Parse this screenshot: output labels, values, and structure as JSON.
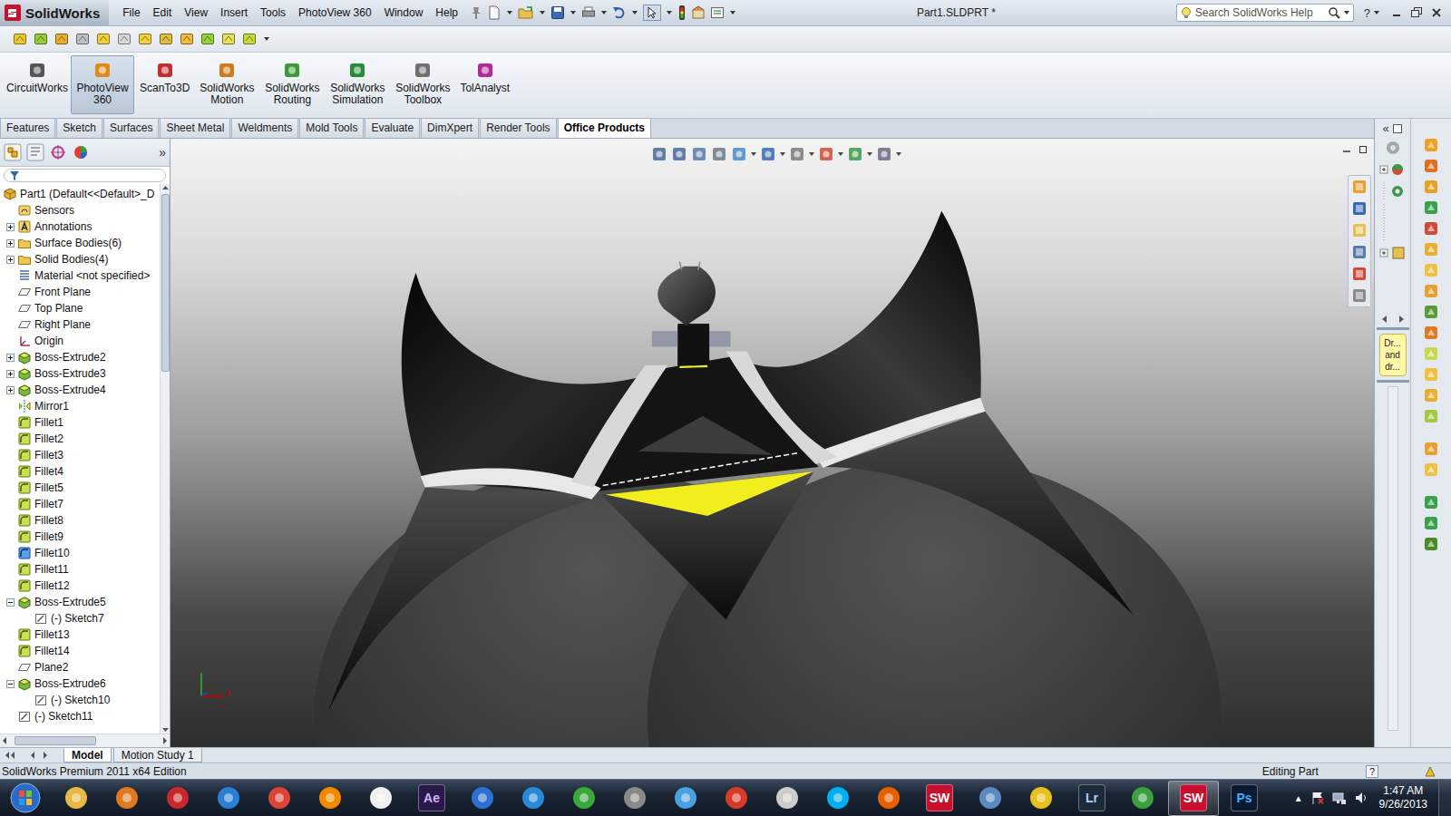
{
  "window": {
    "app": "SolidWorks",
    "title": "Part1.SLDPRT *"
  },
  "menu": [
    "File",
    "Edit",
    "View",
    "Insert",
    "Tools",
    "PhotoView 360",
    "Window",
    "Help"
  ],
  "search": {
    "placeholder": "Search SolidWorks Help"
  },
  "help": "?",
  "command_manager": [
    {
      "label": "CircuitWorks",
      "selected": false,
      "color": "#555555"
    },
    {
      "label": "PhotoView 360",
      "selected": true,
      "color": "#e08a1e"
    },
    {
      "label": "ScanTo3D",
      "selected": false,
      "color": "#c03030"
    },
    {
      "label": "SolidWorks Motion",
      "selected": false,
      "color": "#d07a20"
    },
    {
      "label": "SolidWorks Routing",
      "selected": false,
      "color": "#3a9a3a"
    },
    {
      "label": "SolidWorks Simulation",
      "selected": false,
      "color": "#2a8a3a"
    },
    {
      "label": "SolidWorks Toolbox",
      "selected": false,
      "color": "#707070"
    },
    {
      "label": "TolAnalyst",
      "selected": false,
      "color": "#b02a9a"
    }
  ],
  "tabs": [
    {
      "label": "Features",
      "selected": false
    },
    {
      "label": "Sketch",
      "selected": false
    },
    {
      "label": "Surfaces",
      "selected": false
    },
    {
      "label": "Sheet Metal",
      "selected": false
    },
    {
      "label": "Weldments",
      "selected": false
    },
    {
      "label": "Mold Tools",
      "selected": false
    },
    {
      "label": "Evaluate",
      "selected": false
    },
    {
      "label": "DimXpert",
      "selected": false
    },
    {
      "label": "Render Tools",
      "selected": false
    },
    {
      "label": "Office Products",
      "selected": true
    }
  ],
  "feature_tree": {
    "more": "»",
    "items": [
      {
        "label": "Part1  (Default<<Default>_D",
        "kind": "part",
        "depth": 0,
        "expandable": false,
        "expanded": false
      },
      {
        "label": "Sensors",
        "kind": "sensor",
        "depth": 1,
        "expandable": false,
        "expanded": false
      },
      {
        "label": "Annotations",
        "kind": "annotation",
        "depth": 1,
        "expandable": true,
        "expanded": false
      },
      {
        "label": "Surface Bodies(6)",
        "kind": "folder",
        "depth": 1,
        "expandable": true,
        "expanded": false
      },
      {
        "label": "Solid Bodies(4)",
        "kind": "folder",
        "depth": 1,
        "expandable": true,
        "expanded": false
      },
      {
        "label": "Material <not specified>",
        "kind": "material",
        "depth": 1,
        "expandable": false,
        "expanded": false
      },
      {
        "label": "Front Plane",
        "kind": "plane",
        "depth": 1,
        "expandable": false,
        "expanded": false
      },
      {
        "label": "Top Plane",
        "kind": "plane",
        "depth": 1,
        "expandable": false,
        "expanded": false
      },
      {
        "label": "Right Plane",
        "kind": "plane",
        "depth": 1,
        "expandable": false,
        "expanded": false
      },
      {
        "label": "Origin",
        "kind": "origin",
        "depth": 1,
        "expandable": false,
        "expanded": false
      },
      {
        "label": "Boss-Extrude2",
        "kind": "extrude",
        "depth": 1,
        "expandable": true,
        "expanded": false
      },
      {
        "label": "Boss-Extrude3",
        "kind": "extrude",
        "depth": 1,
        "expandable": true,
        "expanded": false
      },
      {
        "label": "Boss-Extrude4",
        "kind": "extrude",
        "depth": 1,
        "expandable": true,
        "expanded": false
      },
      {
        "label": "Mirror1",
        "kind": "mirror",
        "depth": 1,
        "expandable": false,
        "expanded": false
      },
      {
        "label": "Fillet1",
        "kind": "fillet",
        "depth": 1,
        "expandable": false,
        "expanded": false
      },
      {
        "label": "Fillet2",
        "kind": "fillet",
        "depth": 1,
        "expandable": false,
        "expanded": false
      },
      {
        "label": "Fillet3",
        "kind": "fillet",
        "depth": 1,
        "expandable": false,
        "expanded": false
      },
      {
        "label": "Fillet4",
        "kind": "fillet",
        "depth": 1,
        "expandable": false,
        "expanded": false
      },
      {
        "label": "Fillet5",
        "kind": "fillet",
        "depth": 1,
        "expandable": false,
        "expanded": false
      },
      {
        "label": "Fillet7",
        "kind": "fillet",
        "depth": 1,
        "expandable": false,
        "expanded": false
      },
      {
        "label": "Fillet8",
        "kind": "fillet",
        "depth": 1,
        "expandable": false,
        "expanded": false
      },
      {
        "label": "Fillet9",
        "kind": "fillet",
        "depth": 1,
        "expandable": false,
        "expanded": false
      },
      {
        "label": "Fillet10",
        "kind": "variable-fillet",
        "depth": 1,
        "expandable": false,
        "expanded": false
      },
      {
        "label": "Fillet11",
        "kind": "fillet",
        "depth": 1,
        "expandable": false,
        "expanded": false
      },
      {
        "label": "Fillet12",
        "kind": "fillet",
        "depth": 1,
        "expandable": false,
        "expanded": false
      },
      {
        "label": "Boss-Extrude5",
        "kind": "extrude",
        "depth": 1,
        "expandable": true,
        "expanded": true
      },
      {
        "label": "(-) Sketch7",
        "kind": "sketch",
        "depth": 2,
        "expandable": false,
        "expanded": false
      },
      {
        "label": "Fillet13",
        "kind": "fillet",
        "depth": 1,
        "expandable": false,
        "expanded": false
      },
      {
        "label": "Fillet14",
        "kind": "fillet",
        "depth": 1,
        "expandable": false,
        "expanded": false
      },
      {
        "label": "Plane2",
        "kind": "plane",
        "depth": 1,
        "expandable": false,
        "expanded": false
      },
      {
        "label": "Boss-Extrude6",
        "kind": "extrude",
        "depth": 1,
        "expandable": true,
        "expanded": true
      },
      {
        "label": "(-) Sketch10",
        "kind": "sketch",
        "depth": 2,
        "expandable": false,
        "expanded": false
      },
      {
        "label": "(-) Sketch11",
        "kind": "sketch",
        "depth": 1,
        "expandable": false,
        "expanded": false
      }
    ]
  },
  "viewport": {
    "triad_x": "x"
  },
  "task_pane": {
    "collapse": "«",
    "note": [
      "Dr...",
      "and",
      "dr..."
    ]
  },
  "model_tabs": [
    {
      "label": "Model",
      "selected": true
    },
    {
      "label": "Motion Study 1",
      "selected": false
    }
  ],
  "status_bar": {
    "edition": "SolidWorks Premium 2011 x64 Edition",
    "mode": "Editing Part",
    "help": "?"
  },
  "taskbar": {
    "apps": [
      {
        "color": "#e8b84a",
        "selected": false
      },
      {
        "color": "#e07a20",
        "selected": false
      },
      {
        "color": "#c8282c",
        "selected": false
      },
      {
        "color": "#2a7fd4",
        "selected": false
      },
      {
        "color": "#db4437",
        "selected": false
      },
      {
        "color": "#f28a00",
        "selected": false
      },
      {
        "color": "#f0f0f0",
        "selected": false
      },
      {
        "label": "Ae",
        "color": "#2a1a4a",
        "selected": false
      },
      {
        "color": "#2d6fd2",
        "selected": false
      },
      {
        "color": "#2a8ad8",
        "selected": false
      },
      {
        "color": "#3aa83a",
        "selected": false
      },
      {
        "color": "#8a8a8a",
        "selected": false
      },
      {
        "color": "#4aa0e0",
        "selected": false
      },
      {
        "color": "#d63a2a",
        "selected": false
      },
      {
        "color": "#cccccc",
        "selected": false
      },
      {
        "color": "#00aff0",
        "selected": false
      },
      {
        "color": "#e66000",
        "selected": false
      },
      {
        "label": "SW",
        "color": "#c8102e",
        "selected": false
      },
      {
        "color": "#5a8ac0",
        "selected": false
      },
      {
        "color": "#e8c020",
        "selected": false
      },
      {
        "label": "Lr",
        "color": "#1c2a3a",
        "selected": false
      },
      {
        "color": "#3aa040",
        "selected": false
      },
      {
        "label": "SW",
        "color": "#c8102e",
        "selected": true
      },
      {
        "label": "Ps",
        "color": "#0a1a30",
        "selected": false
      }
    ],
    "show_hidden": "▲",
    "time": "1:47 AM",
    "date": "9/26/2013"
  }
}
